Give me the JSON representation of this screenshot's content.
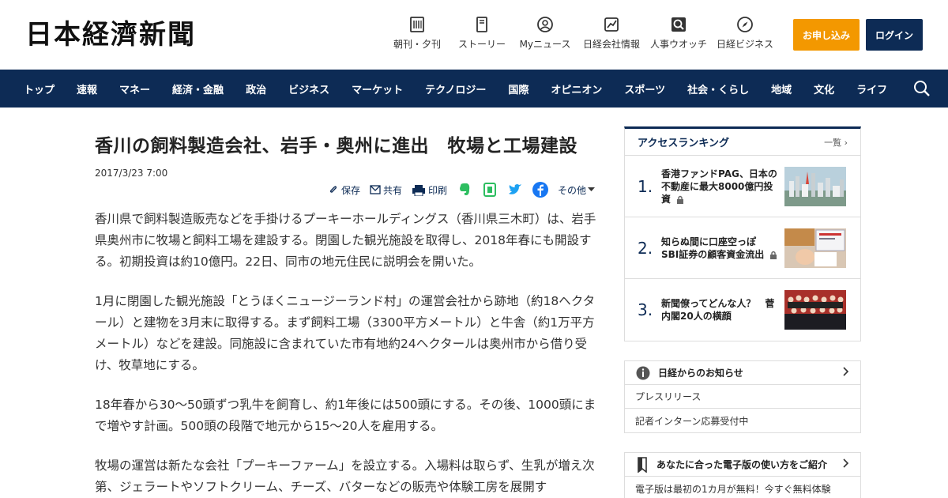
{
  "header": {
    "logo": "日本経濟新聞",
    "nav": [
      {
        "label": "朝刊・夕刊",
        "icon": "newspaper-icon"
      },
      {
        "label": "ストーリー",
        "icon": "book-icon"
      },
      {
        "label": "Myニュース",
        "icon": "person-icon"
      },
      {
        "label": "日経会社情報",
        "icon": "chart-icon"
      },
      {
        "label": "人事ウオッチ",
        "icon": "search-person-icon"
      },
      {
        "label": "日経ビジネス",
        "icon": "compass-icon"
      }
    ],
    "apply_label": "お申し込み",
    "login_label": "ログイン"
  },
  "mainnav": {
    "items": [
      "トップ",
      "速報",
      "マネー",
      "経済・金融",
      "政治",
      "ビジネス",
      "マーケット",
      "テクノロジー",
      "国際",
      "オピニオン",
      "スポーツ",
      "社会・くらし",
      "地域",
      "文化",
      "ライフ"
    ]
  },
  "article": {
    "title": "香川の飼料製造会社、岩手・奥州に進出　牧場と工場建設",
    "date": "2017/3/23 7:00",
    "tools": {
      "save": "保存",
      "share": "共有",
      "print": "印刷",
      "more": "その他"
    },
    "paragraphs": [
      "香川県で飼料製造販売などを手掛けるプーキーホールディングス（香川県三木町）は、岩手県奥州市に牧場と飼料工場を建設する。閉園した観光施設を取得し、2018年春にも開設する。初期投資は約10億円。22日、同市の地元住民に説明会を開いた。",
      "1月に閉園した観光施設「とうほくニュージーランド村」の運営会社から跡地（約18ヘクタール）と建物を3月末に取得する。まず飼料工場（3300平方メートル）と牛舎（約1万平方メートル）などを建設。同施設に含まれていた市有地約24ヘクタールは奥州市から借り受け、牧草地にする。",
      "18年春から30～50頭ずつ乳牛を飼育し、約1年後には500頭にする。その後、1000頭にまで増やす計画。500頭の段階で地元から15～20人を雇用する。",
      "牧場の運営は新たな会社「プーキーファーム」を設立する。入場料は取らず、生乳が増え次第、ジェラートやソフトクリーム、チーズ、バターなどの販売や体験工房を展開す"
    ]
  },
  "ranking": {
    "title": "アクセスランキング",
    "more": "一覧",
    "items": [
      {
        "rank": "1.",
        "text": "香港ファンドPAG、日本の不動産に最大8000億円投資",
        "locked": true
      },
      {
        "rank": "2.",
        "text": "知らぬ間に口座空っぽ　SBI証券の顧客資金流出",
        "locked": true
      },
      {
        "rank": "3.",
        "text": "新聞僚ってどんな人？　菅内閣20人の横顔",
        "locked": false
      }
    ]
  },
  "notice": {
    "title": "日経からのお知らせ",
    "rows": [
      "プレスリリース",
      "記者インターン応募受付中"
    ]
  },
  "guide": {
    "title": "あなたに合った電子版の使い方をご紹介",
    "rows": [
      "電子版は最初の1カ月が無料！今すぐ無料体験"
    ]
  },
  "colors": {
    "navy": "#0d2b55",
    "orange": "#f39800"
  }
}
